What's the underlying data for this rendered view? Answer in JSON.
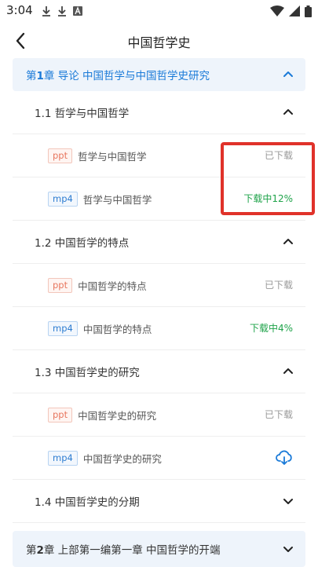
{
  "status_bar": {
    "time": "3:04",
    "left_icons": [
      "download-icon",
      "download-icon",
      "font-icon"
    ],
    "right_icons": [
      "wifi-icon",
      "signal-icon",
      "battery-icon"
    ]
  },
  "header": {
    "title": "中国哲学史",
    "back_icon": "chevron-left-icon"
  },
  "chapters": [
    {
      "prefix": "第",
      "num": "1",
      "suffix": "章 导论 中国哲学与中国哲学史研究",
      "expanded": true,
      "sections": [
        {
          "title": "1.1 哲学与中国哲学",
          "expanded": true,
          "items": [
            {
              "type": "ppt",
              "name": "哲学与中国哲学",
              "status": "已下载"
            },
            {
              "type": "mp4",
              "name": "哲学与中国哲学",
              "status": "下载中12%"
            }
          ]
        },
        {
          "title": "1.2 中国哲学的特点",
          "expanded": true,
          "items": [
            {
              "type": "ppt",
              "name": "中国哲学的特点",
              "status": "已下载"
            },
            {
              "type": "mp4",
              "name": "中国哲学的特点",
              "status": "下载中4%"
            }
          ]
        },
        {
          "title": "1.3 中国哲学史的研究",
          "expanded": true,
          "items": [
            {
              "type": "ppt",
              "name": "中国哲学史的研究",
              "status": "已下载"
            },
            {
              "type": "mp4",
              "name": "中国哲学史的研究",
              "status": ""
            }
          ]
        },
        {
          "title": "1.4 中国哲学史的分期",
          "expanded": false
        }
      ]
    },
    {
      "prefix": "第",
      "num": "2",
      "suffix": "章 上部第一编第一章 中国哲学的开端",
      "expanded": false
    }
  ],
  "colors": {
    "accent": "#1a7ad8",
    "progress": "#1fa34a",
    "highlight_box": "#e0322a",
    "chapter_bg": "#eef4fb"
  }
}
